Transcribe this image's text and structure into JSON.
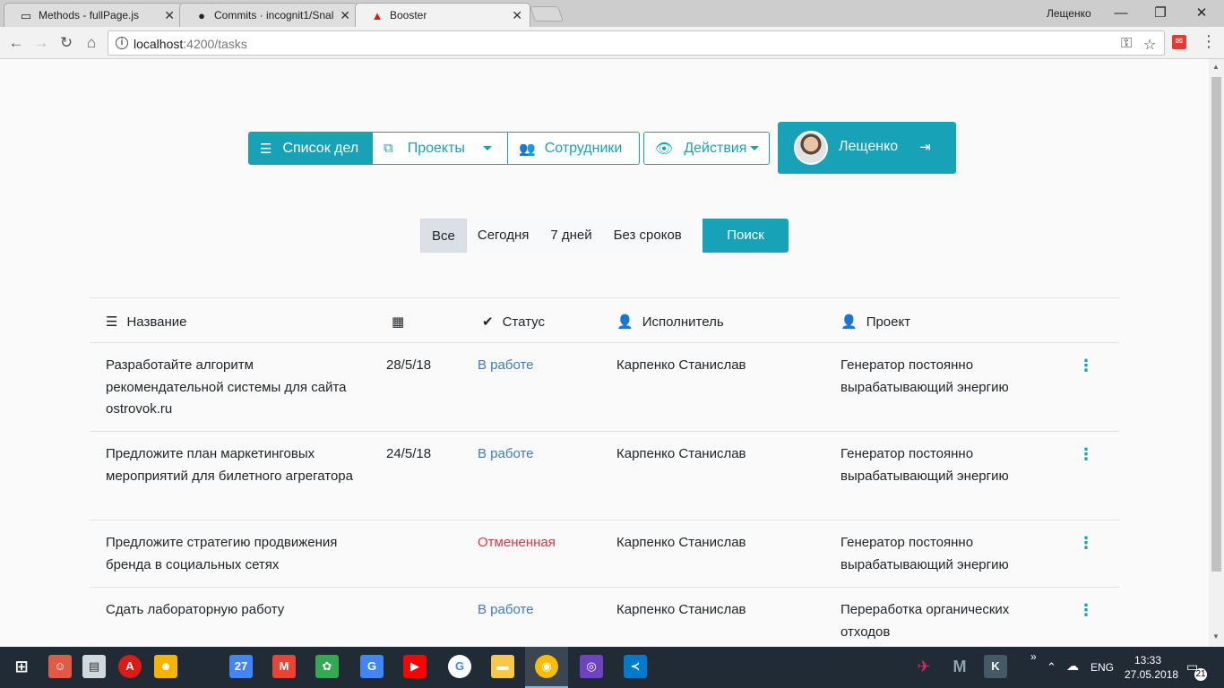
{
  "browser": {
    "tabs": [
      {
        "title": "Methods - fullPage.js",
        "icon": "page-icon"
      },
      {
        "title": "Commits · incognit1/Snal",
        "icon": "github-icon"
      },
      {
        "title": "Booster",
        "icon": "angular-icon"
      }
    ],
    "profile_name": "Лещенко",
    "url_host": "localhost",
    "url_path": ":4200/tasks"
  },
  "nav": {
    "tasks": "Список дел",
    "projects": "Проекты",
    "employees": "Сотрудники",
    "actions": "Действия",
    "user": "Лещенко"
  },
  "filters": {
    "all": "Все",
    "today": "Сегодня",
    "week": "7 дней",
    "no_deadline": "Без сроков",
    "search": "Поиск"
  },
  "table": {
    "headers": {
      "name": "Название",
      "status": "Статус",
      "executor": "Исполнитель",
      "project": "Проект"
    },
    "rows": [
      {
        "name": "Разработайте алгоритм рекомендательной системы для сайта ostrovok.ru",
        "date": "28/5/18",
        "status": "В работе",
        "executor": "Карпенко Станислав",
        "project": "Генератор постоянно вырабатывающий энергию"
      },
      {
        "name": "Предложите план маркетинговых мероприятий для билетного агрегатора",
        "date": "24/5/18",
        "status": "В работе",
        "executor": "Карпенко Станислав",
        "project": "Генератор постоянно вырабатывающий энергию"
      },
      {
        "name": "Предложите стратегию продвижения бренда в социальных сетях",
        "date": "",
        "status": "Отмененная",
        "executor": "Карпенко Станислав",
        "project": "Генератор постоянно вырабатывающий энергию"
      },
      {
        "name": "Сдать лабораторную работу",
        "date": "",
        "status": "В работе",
        "executor": "Карпенко Станислав",
        "project": "Переработка органических отходов"
      }
    ]
  },
  "taskbar": {
    "lang": "ENG",
    "time": "13:33",
    "date": "27.05.2018",
    "notifications": "21",
    "calendar_day": "27"
  },
  "colors": {
    "accent": "#17a2b8",
    "status_work": "#3d7bc6",
    "status_cancel": "#dc3545"
  }
}
